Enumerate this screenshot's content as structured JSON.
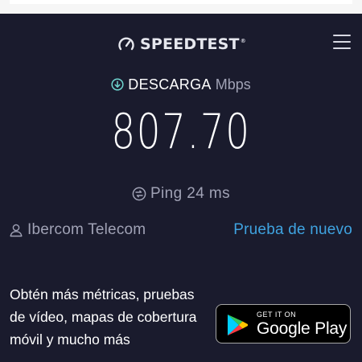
{
  "header": {
    "logo_text": "SPEEDTEST",
    "logo_tm": "®",
    "logo_icon": "speedometer-gauge-icon",
    "menu_icon": "hamburger-menu-icon"
  },
  "download": {
    "label": "DESCARGA",
    "unit": "Mbps",
    "value": "807.70",
    "icon": "download-arrow-circle-icon"
  },
  "ping": {
    "label": "Ping",
    "value": "24",
    "unit": "ms",
    "text": "Ping 24 ms",
    "icon": "ping-circle-icon"
  },
  "provider": {
    "name": "Ibercom Telecom",
    "icon": "user-icon"
  },
  "actions": {
    "retry_label": "Prueba de nuevo"
  },
  "promo": {
    "text": "Obtén más métricas, pruebas de vídeo, mapas de cobertura móvil y mucho más"
  },
  "store_badge": {
    "small_text": "GET IT ON",
    "big_text": "Google Play",
    "icon": "google-play-logo-icon"
  },
  "colors": {
    "background": "#1a1b2d",
    "accent": "#3fa3e0",
    "muted_text": "#a0a2b5",
    "download_icon": "#6fd6d0"
  }
}
